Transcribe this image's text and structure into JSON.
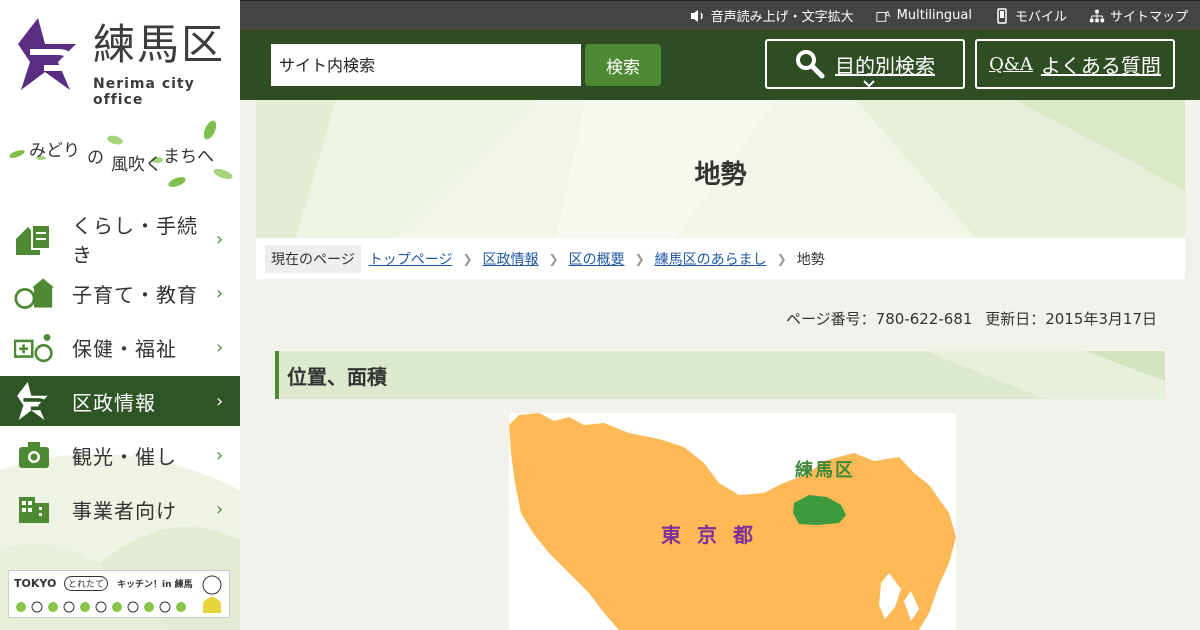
{
  "header": {
    "logo": {
      "name": "練馬区",
      "subtitle": "Nerima city office"
    },
    "tagline": {
      "parts": [
        "みどり",
        "の",
        "風吹く",
        "まちへ"
      ]
    },
    "utility": [
      {
        "label": "音声読み上げ・文字拡大",
        "icon": "speaker-icon"
      },
      {
        "label": "Multilingual",
        "icon": "translate-icon"
      },
      {
        "label": "モバイル",
        "icon": "mobile-icon"
      },
      {
        "label": "サイトマップ",
        "icon": "sitemap-icon"
      }
    ],
    "search": {
      "placeholder": "サイト内検索",
      "button": "検索"
    },
    "purpose_search": "目的別検索",
    "faq": {
      "prefix": "Q&A",
      "label": "よくある質問"
    }
  },
  "sidebar": {
    "items": [
      {
        "label": "くらし・手続き",
        "icon": "house-form-icon",
        "active": false
      },
      {
        "label": "子育て・教育",
        "icon": "child-school-icon",
        "active": false
      },
      {
        "label": "保健・福祉",
        "icon": "health-welfare-icon",
        "active": false
      },
      {
        "label": "区政情報",
        "icon": "nerima-emblem-icon",
        "active": true
      },
      {
        "label": "観光・催し",
        "icon": "camera-icon",
        "active": false
      },
      {
        "label": "事業者向け",
        "icon": "building-icon",
        "active": false
      }
    ],
    "banner": {
      "text_a": "TOKYO",
      "text_b": "とれたて",
      "text_c": "キッチン！in 練馬"
    }
  },
  "page": {
    "title": "地勢",
    "breadcrumb": {
      "label": "現在のページ",
      "links": [
        "トップページ",
        "区政情報",
        "区の概要",
        "練馬区のあらまし"
      ],
      "current": "地勢"
    },
    "meta": {
      "page_number": "ページ番号：780-622-681",
      "updated": "更新日：2015年3月17日"
    },
    "section_heading": "位置、面積",
    "map": {
      "label_nerima": "練馬区",
      "label_tokyo": "東京都"
    }
  },
  "colors": {
    "header_green": "#2e4d22",
    "accent_green": "#4e8a33",
    "sidebar_active": "#2e5525",
    "utility_bar": "#444444",
    "map_orange": "#fdb956",
    "map_green": "#3c9a3c"
  }
}
